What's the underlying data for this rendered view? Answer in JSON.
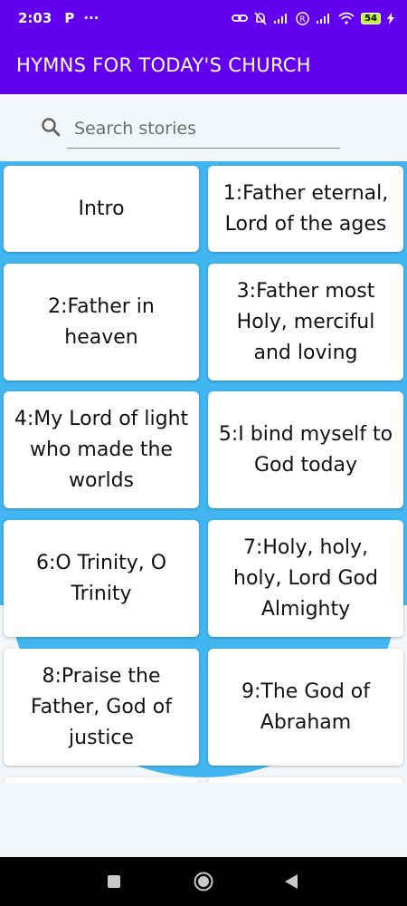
{
  "status_bar": {
    "time": "2:03",
    "left_icons": [
      "P",
      "···"
    ],
    "battery_level": "54"
  },
  "app_bar": {
    "title": "HYMNS FOR TODAY'S CHURCH"
  },
  "search": {
    "placeholder": "Search stories",
    "value": ""
  },
  "cards": [
    {
      "label": "Intro"
    },
    {
      "label": "1:Father eternal, Lord of the ages"
    },
    {
      "label": "2:Father in heaven"
    },
    {
      "label": "3:Father most Holy, merciful and loving"
    },
    {
      "label": "4:My Lord of light who made the worlds"
    },
    {
      "label": "5:I bind myself to God today"
    },
    {
      "label": "6:O Trinity, O Trinity"
    },
    {
      "label": "7:Holy, holy, holy, Lord God Almighty"
    },
    {
      "label": "8:Praise the Father, God of justice"
    },
    {
      "label": "9:The God of Abraham"
    },
    {
      "label": ""
    },
    {
      "label": ""
    }
  ],
  "colors": {
    "primary": "#6200ee",
    "accent_bg": "#42b6f0",
    "page_bg": "#f2f6f8",
    "card_bg": "#ffffff"
  },
  "icons": [
    "search-icon",
    "notification-muted-icon",
    "signal-icon",
    "wifi-icon",
    "battery-icon",
    "nav-recents-icon",
    "nav-home-icon",
    "nav-back-icon"
  ]
}
